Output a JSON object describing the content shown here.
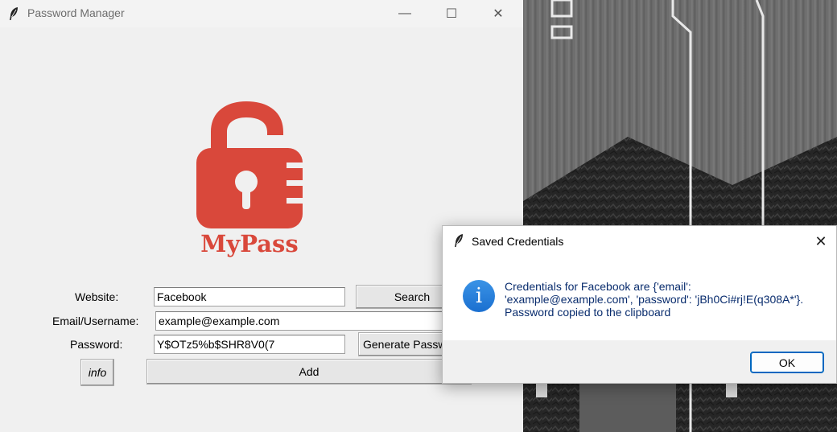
{
  "main_window": {
    "title": "Password Manager",
    "logo_text": "MyPass",
    "logo_color": "#d9483b",
    "controls": {
      "minimize": "—",
      "maximize": "☐",
      "close": "✕"
    },
    "form": {
      "website_label": "Website:",
      "website_value": "Facebook",
      "search_button": "Search",
      "email_label": "Email/Username:",
      "email_value": "example@example.com",
      "password_label": "Password:",
      "password_value": "Y$OTz5%b$SHR8V0(7",
      "generate_button": "Generate Password",
      "info_button": "info",
      "add_button": "Add"
    }
  },
  "dialog": {
    "title": "Saved Credentials",
    "close_glyph": "✕",
    "info_glyph": "i",
    "message_line1": "Credentials for Facebook are {'email':",
    "message_line2": "'example@example.com', 'password': 'jBh0Ci#rj!E(q308A*'}.",
    "message_line3": "Password copied to the clipboard",
    "ok_button": "OK"
  }
}
